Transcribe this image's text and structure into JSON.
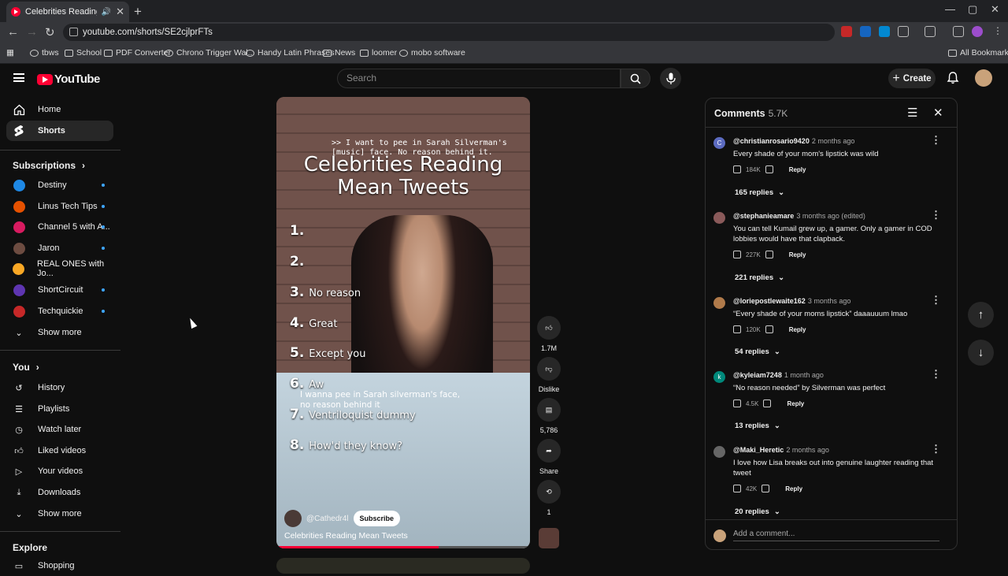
{
  "browser": {
    "tab_title": "Celebrities Reading Mean T",
    "url": "youtube.com/shorts/SE2cjlprFTs",
    "bookmarks": [
      "tbws",
      "School",
      "PDF Converter",
      "Chrono Trigger Wal...",
      "Handy Latin Phrases",
      "News",
      "loomer",
      "mobo software"
    ],
    "all_bookmarks": "All Bookmarks"
  },
  "header": {
    "logo_text": "YouTube",
    "search_placeholder": "Search",
    "create_label": "Create"
  },
  "sidebar": {
    "home": "Home",
    "shorts": "Shorts",
    "subscriptions_title": "Subscriptions",
    "subscriptions": [
      "Destiny",
      "Linus Tech Tips",
      "Channel 5 with A...",
      "Jaron",
      "REAL ONES with Jo...",
      "ShortCircuit",
      "Techquickie"
    ],
    "show_more": "Show more",
    "you_title": "You",
    "you_items": [
      "History",
      "Playlists",
      "Watch later",
      "Liked videos",
      "Your videos",
      "Downloads"
    ],
    "show_more_2": "Show more",
    "explore_title": "Explore",
    "explore_first": "Shopping"
  },
  "video": {
    "caption": ">> I want to pee in Sarah Silverman's\n[music] face. No reason behind it.",
    "title_line1": "Celebrities Reading",
    "title_line2": "Mean Tweets",
    "list": [
      {
        "n": "1.",
        "t": ""
      },
      {
        "n": "2.",
        "t": ""
      },
      {
        "n": "3.",
        "t": "No reason"
      },
      {
        "n": "4.",
        "t": "Great"
      },
      {
        "n": "5.",
        "t": "Except you"
      },
      {
        "n": "6.",
        "t": "Aw"
      },
      {
        "n": "7.",
        "t": "Ventriloquist dummy"
      },
      {
        "n": "8.",
        "t": "How'd they know?"
      }
    ],
    "subcaption": "I wanna pee in Sarah silverman's face,\nno reason behind it",
    "channel": "@Cathedr4l",
    "subscribe": "Subscribe",
    "bottom_title": "Celebrities Reading Mean Tweets",
    "progress": 0.64,
    "likes": "1.7M",
    "dislike": "Dislike",
    "comments_count": "5,786",
    "share": "Share",
    "remix_count": "1"
  },
  "comments": {
    "title": "Comments",
    "count": "5.7K",
    "items": [
      {
        "initial": "C",
        "author": "@christianrosario9420",
        "time": "2 months ago",
        "text": "Every shade of your mom's lipstick was wild",
        "likes": "184K",
        "replies": "165 replies",
        "color": "#5c6bc0"
      },
      {
        "initial": "",
        "author": "@stephanieamare",
        "time": "3 months ago (edited)",
        "text": "You can tell Kumail grew up, a gamer. Only a gamer in COD lobbies would have that clapback.",
        "likes": "227K",
        "replies": "221 replies",
        "color": "#8a5a5a"
      },
      {
        "initial": "",
        "author": "@loriepostlewaite162",
        "time": "3 months ago",
        "text": "“Every shade of your moms lipstick” daaauuum lmao",
        "likes": "120K",
        "replies": "54 replies",
        "color": "#b07a4a"
      },
      {
        "initial": "k",
        "author": "@kyleiam7248",
        "time": "1 month ago",
        "text": "“No reason needed” by Silverman was perfect",
        "likes": "4.5K",
        "replies": "13 replies",
        "color": "#00897b"
      },
      {
        "initial": "",
        "author": "@Maki_Heretic",
        "time": "2 months ago",
        "text": "I love how Lisa breaks out into genuine laughter reading that tweet",
        "likes": "42K",
        "replies": "20 replies",
        "color": "#666"
      }
    ],
    "reply_label": "Reply",
    "add_placeholder": "Add a comment..."
  }
}
